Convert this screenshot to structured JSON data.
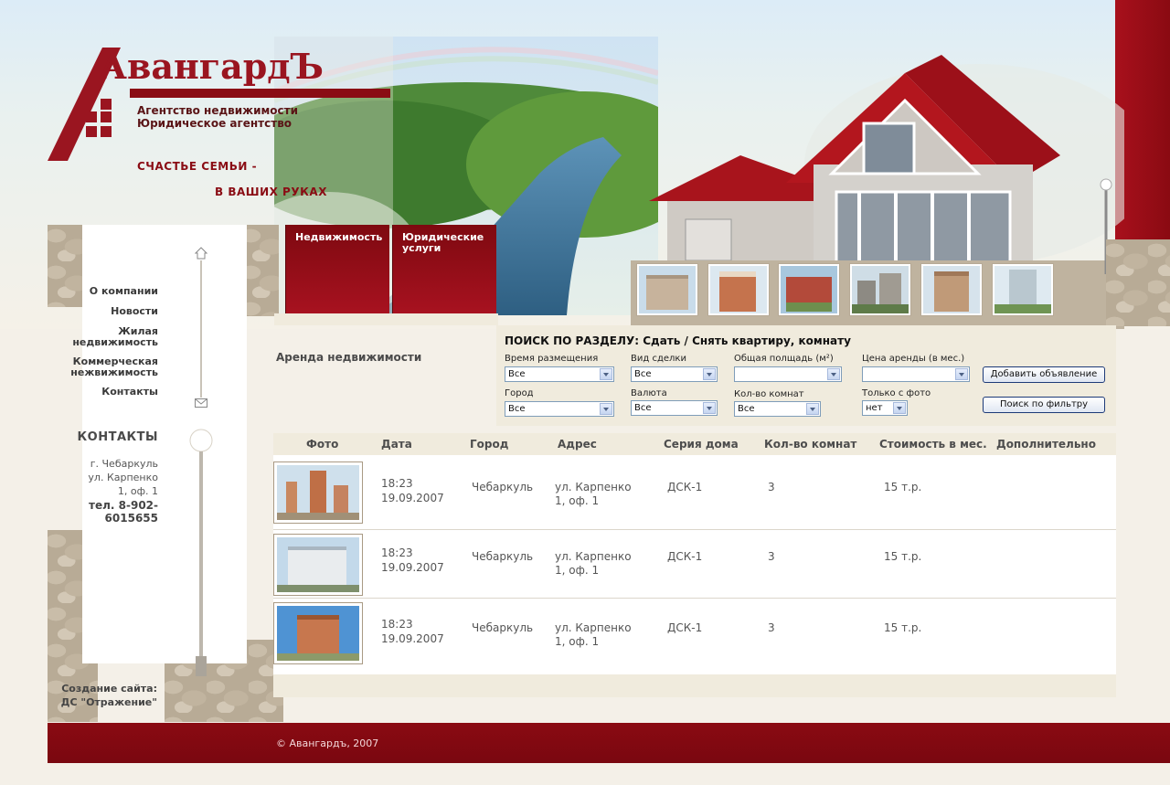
{
  "logo": {
    "title": "АвангардЪ",
    "sub1": "Агентство недвижимости",
    "sub2": "Юридическое агентство"
  },
  "slogan": {
    "line1": "СЧАСТЬЕ СЕМЬИ -",
    "line2": "В ВАШИХ РУКАХ"
  },
  "tabs": [
    {
      "label": "Недвижимость"
    },
    {
      "label": "Юридические услуги"
    }
  ],
  "nav": [
    {
      "label": "О компании"
    },
    {
      "label": "Новости"
    },
    {
      "label": "Жилая недвижимость"
    },
    {
      "label": "Коммерческая нежвижимость"
    },
    {
      "label": "Контакты"
    }
  ],
  "contacts": {
    "title": "КОНТАКТЫ",
    "city": "г. Чебаркуль",
    "street": "ул. Карпенко",
    "office": "1, оф. 1",
    "phone": "тел. 8-902-6015655"
  },
  "created_by": {
    "line1": "Создание сайта:",
    "line2": "ДС \"Отражение\""
  },
  "section_title": "Аренда недвижимости",
  "filter": {
    "title": "ПОИСК ПО РАЗДЕЛУ:  Сдать / Снять квартиру, комнату",
    "fields": {
      "time_label": "Время размещения",
      "time_value": "Все",
      "deal_label": "Вид сделки",
      "deal_value": "Все",
      "area_label": "Общая полщадь (м²)",
      "area_value": "",
      "price_label": "Цена аренды (в мес.)",
      "price_value": "",
      "city_label": "Город",
      "city_value": "Все",
      "currency_label": "Валюта",
      "currency_value": "Все",
      "rooms_label": "Кол-во комнат",
      "rooms_value": "Все",
      "photo_label": "Только с фото",
      "photo_value": "нет"
    },
    "add_button": "Добавить объявление",
    "search_button": "Поиск по фильтру"
  },
  "table": {
    "headers": [
      "Фото",
      "Дата",
      "Город",
      "Адрес",
      "Серия дома",
      "Кол-во комнат",
      "Стоимость в мес.",
      "Дополнительно"
    ],
    "rows": [
      {
        "time": "18:23",
        "date": "19.09.2007",
        "city": "Чебаркуль",
        "addr1": "ул. Карпенко",
        "addr2": "1, оф. 1",
        "series": "ДСК-1",
        "rooms": "3",
        "price": "15 т.р."
      },
      {
        "time": "18:23",
        "date": "19.09.2007",
        "city": "Чебаркуль",
        "addr1": "ул. Карпенко",
        "addr2": "1, оф. 1",
        "series": "ДСК-1",
        "rooms": "3",
        "price": "15 т.р."
      },
      {
        "time": "18:23",
        "date": "19.09.2007",
        "city": "Чебаркуль",
        "addr1": "ул. Карпенко",
        "addr2": "1, оф. 1",
        "series": "ДСК-1",
        "rooms": "3",
        "price": "15 т.р."
      }
    ]
  },
  "footer": {
    "copyright": "© Авангардъ, 2007"
  },
  "colors": {
    "brand_red": "#8a0a12",
    "panel_beige": "#f0ebdd"
  }
}
